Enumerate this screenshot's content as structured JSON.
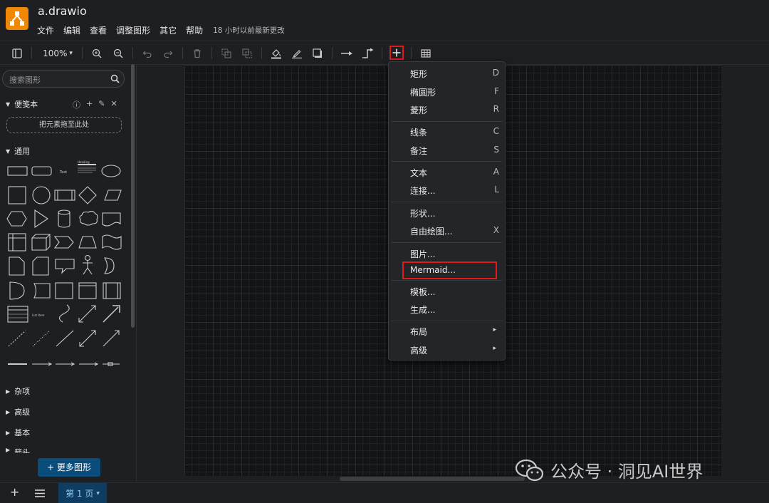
{
  "title": "a.drawio",
  "menu": [
    "文件",
    "编辑",
    "查看",
    "调整图形",
    "其它",
    "帮助"
  ],
  "last_saved": "18 小时以前最新更改",
  "toolbar": {
    "zoom": "100%"
  },
  "sidebar": {
    "search_placeholder": "搜索图形",
    "scratchpad_title": "便笺本",
    "drop_hint": "把元素拖至此处",
    "general_title": "通用",
    "collapsed_sections": [
      "杂项",
      "高级",
      "基本",
      "箭头"
    ],
    "more_shapes": "+ 更多图形",
    "shape_text_label": "Text",
    "shape_heading_label": "Heading",
    "shape_list_label": "List Item"
  },
  "insert_menu": [
    {
      "label": "矩形",
      "key": "D"
    },
    {
      "label": "椭圆形",
      "key": "F"
    },
    {
      "label": "菱形",
      "key": "R"
    },
    {
      "label": "线条",
      "key": "C"
    },
    {
      "label": "备注",
      "key": "S"
    },
    {
      "label": "文本",
      "key": "A"
    },
    {
      "label": "连接...",
      "key": "L"
    },
    {
      "label": "形状...",
      "key": ""
    },
    {
      "label": "自由绘图...",
      "key": "X"
    },
    {
      "label": "图片...",
      "key": ""
    },
    {
      "label": "Mermaid...",
      "key": ""
    },
    {
      "label": "模板...",
      "key": ""
    },
    {
      "label": "生成...",
      "key": ""
    },
    {
      "label": "布局",
      "key": "▸"
    },
    {
      "label": "高级",
      "key": "▸"
    }
  ],
  "page_tab": "第 1 页",
  "watermark": "公众号 · 洞见AI世界",
  "colors": {
    "accent": "#f08705",
    "highlight": "#e0191b",
    "tab": "#0e3d61"
  }
}
